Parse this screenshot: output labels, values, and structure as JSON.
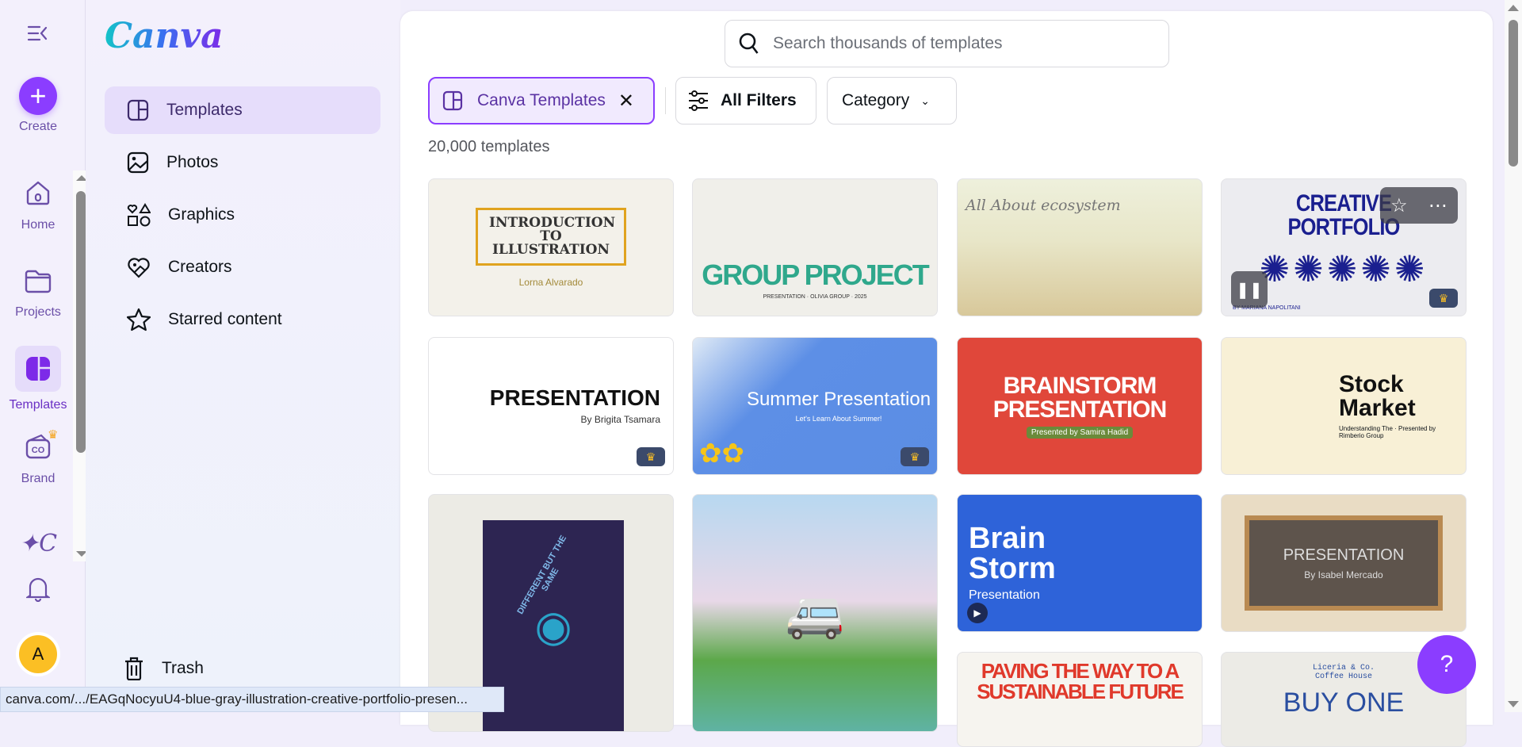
{
  "rail": {
    "create": "Create",
    "home": "Home",
    "projects": "Projects",
    "templates": "Templates",
    "brand": "Brand",
    "avatar_initial": "A"
  },
  "panel": {
    "logo": "Canva",
    "items": [
      {
        "label": "Templates",
        "icon": "templates-icon"
      },
      {
        "label": "Photos",
        "icon": "photo-icon"
      },
      {
        "label": "Graphics",
        "icon": "shapes-icon"
      },
      {
        "label": "Creators",
        "icon": "heart-icon"
      },
      {
        "label": "Starred content",
        "icon": "star-icon"
      }
    ],
    "trash": "Trash"
  },
  "main": {
    "search_placeholder": "Search thousands of templates",
    "filter_chip": "Canva Templates",
    "all_filters": "All Filters",
    "category": "Category",
    "count": "20,000 templates"
  },
  "templates": [
    {
      "title": "INTRODUCTION TO ILLUSTRATION",
      "sub": "Lorna Alvarado"
    },
    {
      "title": "GROUP PROJECT",
      "sub": "PRESENTATION · OLIVIA GROUP · 2025"
    },
    {
      "title": "All About ecosystem",
      "sub": ""
    },
    {
      "title": "CREATIVE PORTFOLIO",
      "sub": "BY MARIANA NAPOLITANI"
    },
    {
      "title": "PRESENTATION",
      "sub": "By Brigita Tsamara"
    },
    {
      "title": "Summer Presentation",
      "sub": "Let's Learn About Summer!"
    },
    {
      "title": "BRAINSTORM PRESENTATION",
      "sub": "Presented by Samira Hadid"
    },
    {
      "title": "Stock Market",
      "sub": "Understanding The · Presented by Rimberio Group"
    },
    {
      "title": "DIFFERENT BUT THE SAME",
      "sub": ""
    },
    {
      "title": "",
      "sub": ""
    },
    {
      "title": "Brain Storm",
      "sub": "Presentation"
    },
    {
      "title": "PRESENTATION",
      "sub": "By Isabel Mercado"
    },
    {
      "title": "PAVING THE WAY TO A SUSTAINABLE FUTURE",
      "sub": ""
    },
    {
      "title": "BUY ONE",
      "sub": "Liceria & Co. Coffee House"
    }
  ],
  "help": "?",
  "status_url": "canva.com/.../EAGqNocyuU4-blue-gray-illustration-creative-portfolio-presen..."
}
